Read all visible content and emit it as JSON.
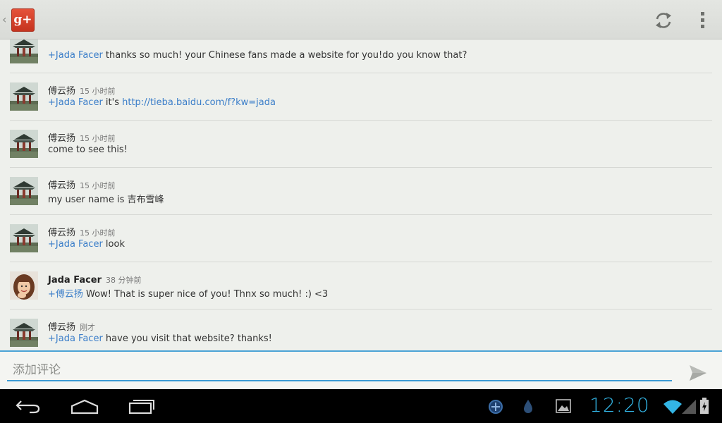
{
  "app": {
    "logo_text": "g+"
  },
  "comments": [
    {
      "author": "",
      "time": "",
      "mention": "+Jada Facer",
      "text": " thanks so much! your Chinese fans made a website for you!do you know that?",
      "avatar": "pagoda"
    },
    {
      "author": "傅云扬",
      "time": "15 小时前",
      "mention": "+Jada Facer",
      "text": " it's ",
      "link": "http://tieba.baidu.com/f?kw=jada",
      "avatar": "pagoda"
    },
    {
      "author": "傅云扬",
      "time": "15 小时前",
      "mention": "",
      "text": "come to see this!",
      "avatar": "pagoda"
    },
    {
      "author": "傅云扬",
      "time": "15 小时前",
      "mention": "",
      "text": "my user name is 吉布雪峰",
      "avatar": "pagoda"
    },
    {
      "author": "傅云扬",
      "time": "15 小时前",
      "mention": "+Jada Facer",
      "text": " look",
      "avatar": "pagoda"
    },
    {
      "author": "Jada Facer",
      "time": "38 分钟前",
      "mention": "+傅云扬",
      "text": " Wow! That is super nice of you! Thnx so much! :)  <3",
      "avatar": "person"
    },
    {
      "author": "傅云扬",
      "time": "刚才",
      "mention": "+Jada Facer",
      "text": " have you visit that website? thanks!",
      "avatar": "pagoda"
    }
  ],
  "compose": {
    "placeholder": "添加评论"
  },
  "status": {
    "clock": "12:20"
  },
  "colors": {
    "accent": "#33b5e5",
    "link": "#3b7ec9",
    "gplus_red": "#d73d28"
  }
}
